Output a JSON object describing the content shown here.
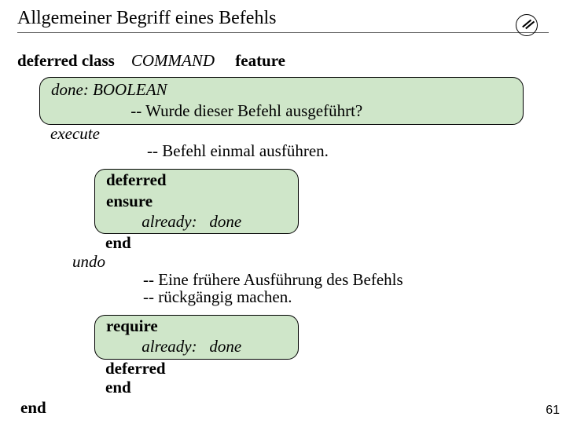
{
  "title": "Allgemeiner Begriff eines Befehls",
  "decl": {
    "deferred_class": "deferred class",
    "class_name": "COMMAND",
    "feature": "feature"
  },
  "done": {
    "text": "done: BOOLEAN",
    "comment": "-- Wurde dieser Befehl ausgeführt?"
  },
  "execute": {
    "name": "execute",
    "comment": "-- Befehl einmal ausführen."
  },
  "ensure_block": {
    "deferred": "deferred",
    "ensure": "ensure",
    "already": "already:",
    "done": "done",
    "end": "end"
  },
  "undo": {
    "name": "undo",
    "comment1": "-- Eine frühere Ausführung des Befehls",
    "comment2": "--  rückgängig machen."
  },
  "require_block": {
    "require": "require",
    "already": "already:",
    "done": "done",
    "deferred": "deferred",
    "end": "end"
  },
  "final_end": "end",
  "page_number": "61"
}
